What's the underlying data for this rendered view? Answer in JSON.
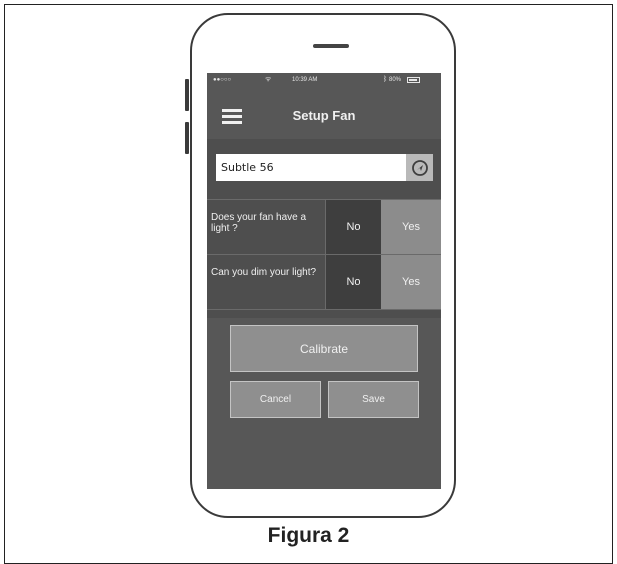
{
  "statusbar": {
    "carrier": "●●○○○",
    "wifi_icon": "wifi-icon",
    "time": "10:39 AM",
    "bluetooth_icon": "bluetooth-icon",
    "battery": "80%"
  },
  "header": {
    "menu_icon": "hamburger-menu-icon",
    "title": "Setup Fan"
  },
  "fan_name": {
    "value": "Subtle 56",
    "locate_icon": "locate-icon"
  },
  "questions": [
    {
      "text": "Does your fan have a light ?",
      "no_label": "No",
      "yes_label": "Yes"
    },
    {
      "text": "Can you dim your light?",
      "no_label": "No",
      "yes_label": "Yes"
    }
  ],
  "actions": {
    "calibrate_label": "Calibrate",
    "cancel_label": "Cancel",
    "save_label": "Save"
  },
  "caption": "Figura 2",
  "colors": {
    "screen_bg": "#575757",
    "selected_option": "#3e3e3e",
    "unselected_option": "#8c8c8c",
    "button_bg": "#8f8f8f"
  }
}
